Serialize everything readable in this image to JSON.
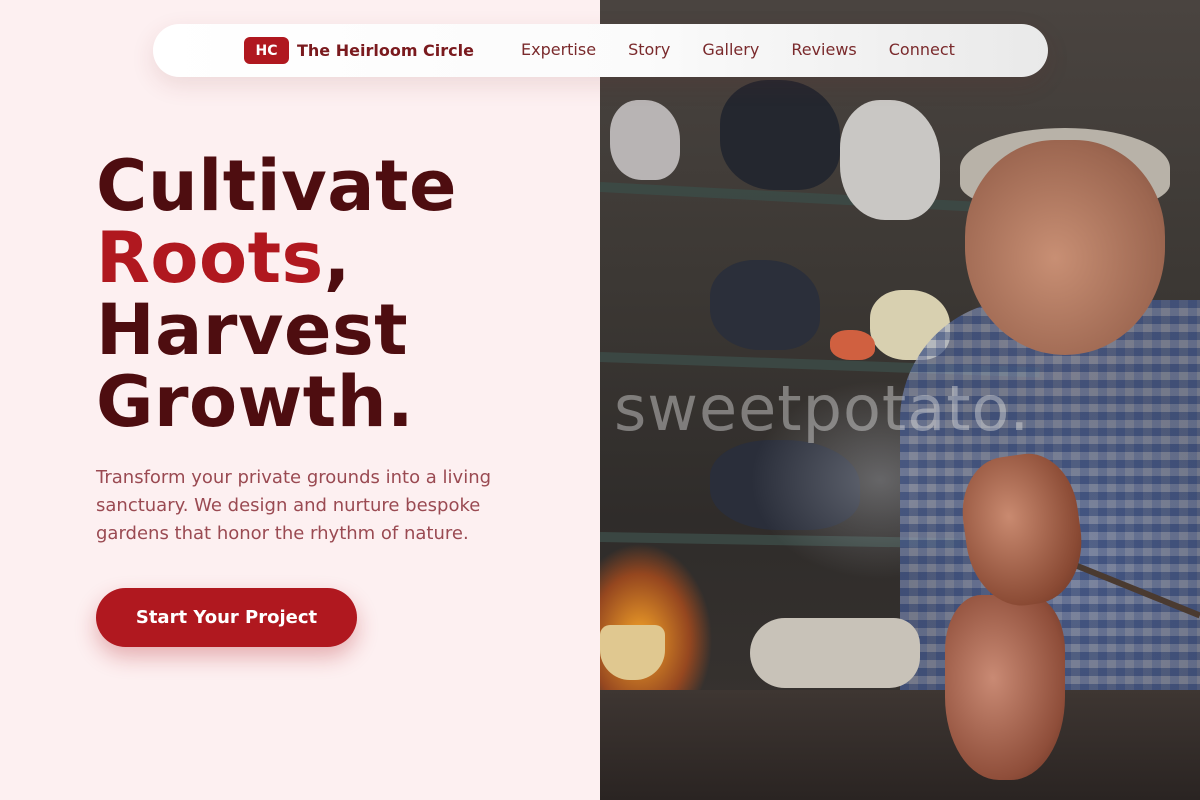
{
  "brand": {
    "badge": "HC",
    "name": "The Heirloom Circle"
  },
  "nav": {
    "links": [
      "Expertise",
      "Story",
      "Gallery",
      "Reviews",
      "Connect"
    ]
  },
  "hero": {
    "line1": "Cultivate",
    "line2_accent": "Roots",
    "line2_rest": ",",
    "line3": "Harvest",
    "line4": "Growth.",
    "description": "Transform your private grounds into a living sanctuary. We design and nurture bespoke gardens that honor the rhythm of nature.",
    "cta_label": "Start Your Project"
  },
  "image": {
    "watermark": "sweetpotato."
  },
  "colors": {
    "accent": "#b0181f",
    "headline": "#4e0d10",
    "background": "#fdf0f1",
    "body_text": "#9a4a52"
  }
}
